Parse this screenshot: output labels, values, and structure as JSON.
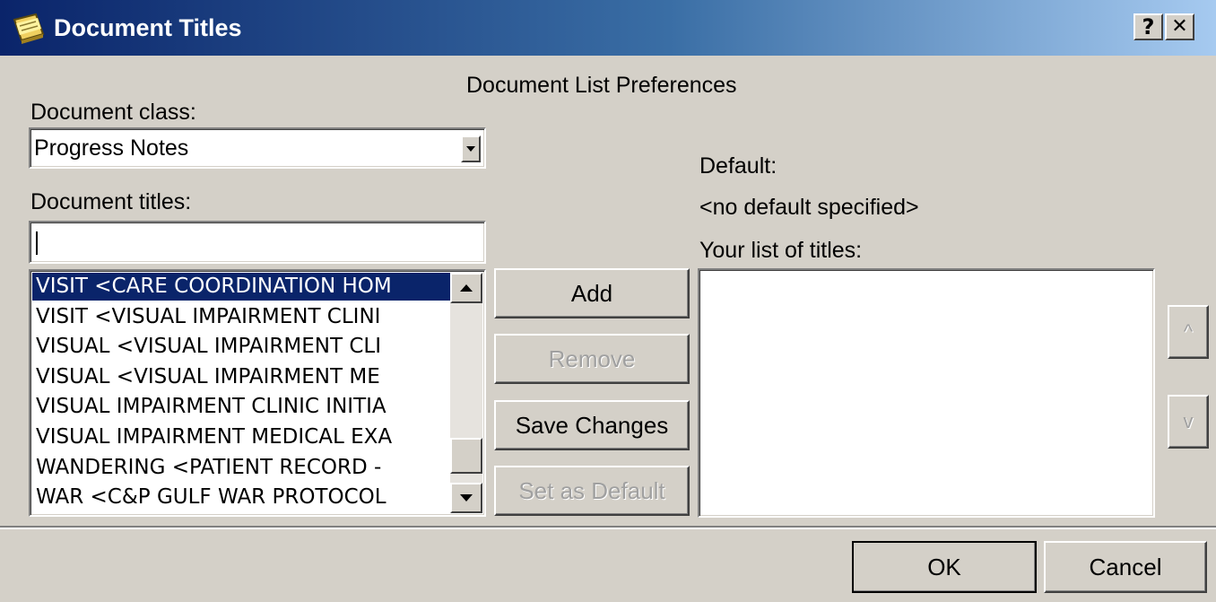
{
  "window": {
    "title": "Document Titles",
    "help_glyph": "?",
    "close_glyph": "✕"
  },
  "header": {
    "text": "Document List Preferences"
  },
  "document_class": {
    "label": "Document class:",
    "selected": "Progress Notes"
  },
  "document_titles": {
    "label": "Document titles:",
    "search_value": "",
    "items": [
      "VISIT  <CARE COORDINATION HOM",
      "VISIT  <VISUAL IMPAIRMENT CLINI",
      "VISUAL  <VISUAL IMPAIRMENT CLI",
      "VISUAL  <VISUAL IMPAIRMENT ME",
      "VISUAL IMPAIRMENT CLINIC INITIA",
      "VISUAL IMPAIRMENT MEDICAL EXA",
      "WANDERING  <PATIENT RECORD -",
      "WAR  <C&P GULF WAR PROTOCOL"
    ],
    "selected_index": 0
  },
  "actions": {
    "add": "Add",
    "remove": "Remove",
    "save_changes": "Save Changes",
    "set_as_default": "Set as Default"
  },
  "default": {
    "label": "Default:",
    "value": "<no default specified>"
  },
  "your_titles": {
    "label": "Your list of titles:",
    "items": []
  },
  "reorder": {
    "up_glyph": "^",
    "down_glyph": "v"
  },
  "footer": {
    "ok": "OK",
    "cancel": "Cancel"
  },
  "colors": {
    "titlebar_start": "#0a246a",
    "selection": "#0a246a",
    "dialog_face": "#d4d0c8"
  }
}
